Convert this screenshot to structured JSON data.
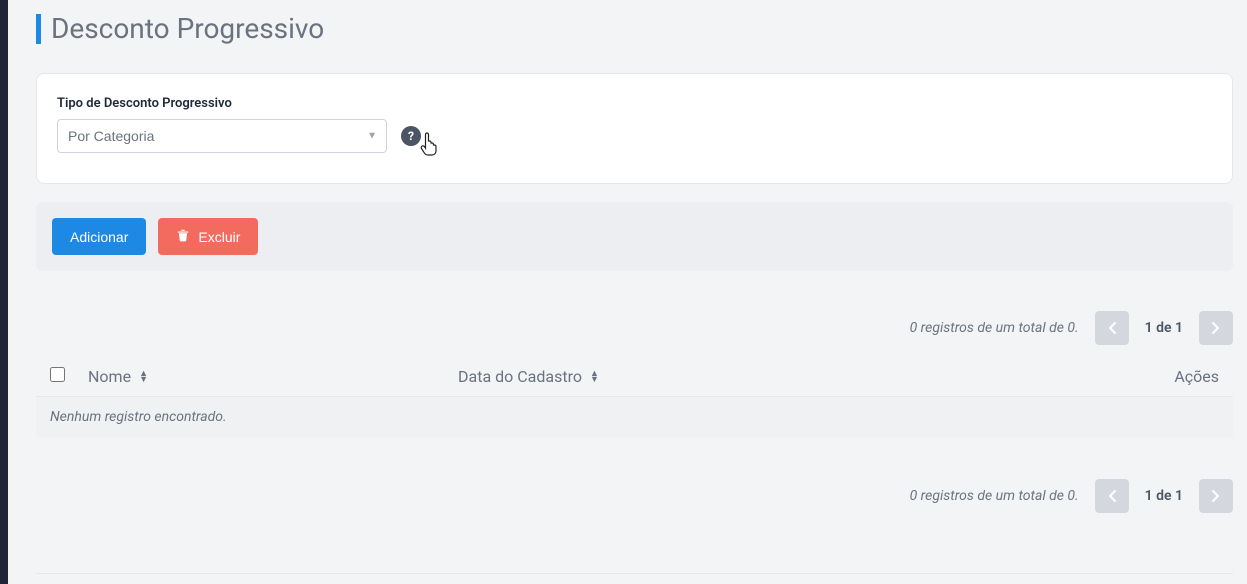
{
  "page": {
    "title": "Desconto Progressivo"
  },
  "form": {
    "type_label": "Tipo de Desconto Progressivo",
    "type_value": "Por Categoria"
  },
  "actions": {
    "add_label": "Adicionar",
    "delete_label": "Excluir"
  },
  "table": {
    "columns": {
      "name": "Nome",
      "date": "Data do Cadastro",
      "actions": "Ações"
    },
    "empty_message": "Nenhum registro encontrado."
  },
  "pagination": {
    "summary": "0 registros de um total de 0.",
    "page_indicator": "1 de 1"
  }
}
